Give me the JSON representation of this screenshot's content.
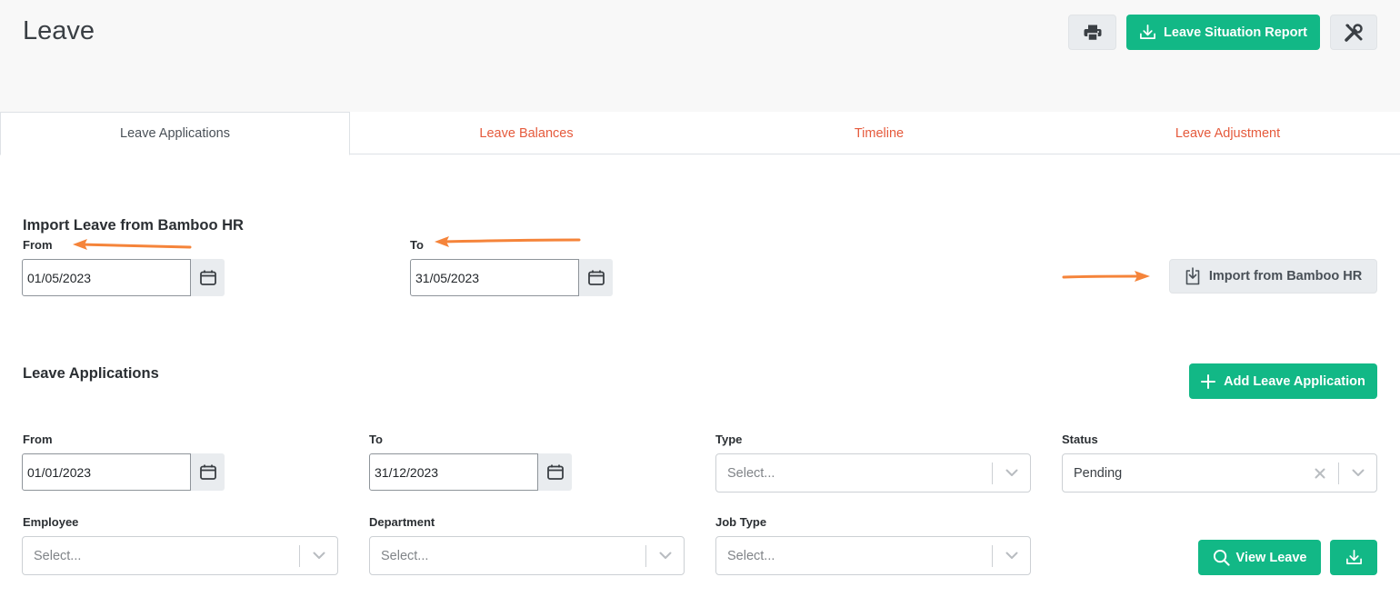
{
  "header": {
    "title": "Leave",
    "print_icon": "printer-icon",
    "report_button_label": "Leave Situation Report",
    "settings_icon": "tools-icon"
  },
  "tabs": [
    {
      "label": "Leave Applications",
      "active": true
    },
    {
      "label": "Leave Balances",
      "active": false
    },
    {
      "label": "Timeline",
      "active": false
    },
    {
      "label": "Leave Adjustment",
      "active": false
    }
  ],
  "import_section": {
    "title": "Import Leave from Bamboo HR",
    "from_label": "From",
    "from_value": "01/05/2023",
    "to_label": "To",
    "to_value": "31/05/2023",
    "import_button_label": "Import from Bamboo HR"
  },
  "applications_section": {
    "title": "Leave Applications",
    "add_button_label": "Add Leave Application",
    "from_label": "From",
    "from_value": "01/01/2023",
    "to_label": "To",
    "to_value": "31/12/2023",
    "type_label": "Type",
    "type_placeholder": "Select...",
    "status_label": "Status",
    "status_value": "Pending",
    "employee_label": "Employee",
    "employee_placeholder": "Select...",
    "department_label": "Department",
    "department_placeholder": "Select...",
    "job_type_label": "Job Type",
    "job_type_placeholder": "Select...",
    "view_button_label": "View Leave"
  },
  "colors": {
    "accent_green": "#12b886",
    "tab_link": "#e55a3c",
    "annotation_arrow": "#f5843a"
  }
}
